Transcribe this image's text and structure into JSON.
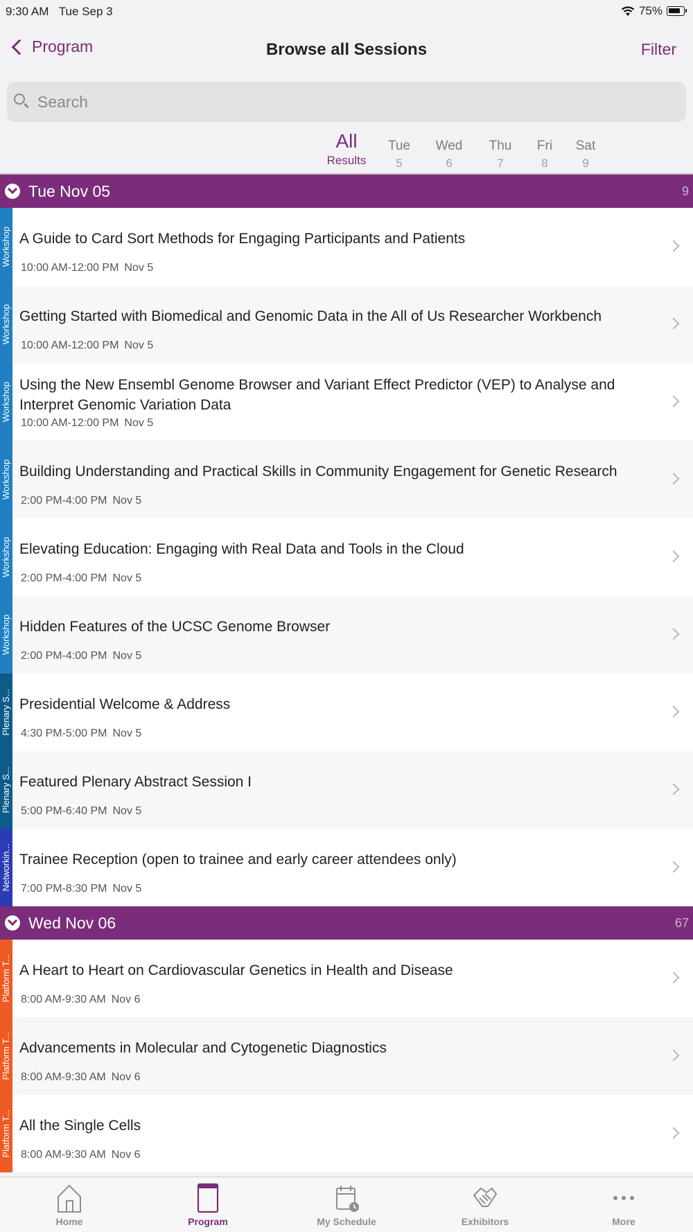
{
  "status_bar": {
    "time": "9:30 AM",
    "date": "Tue Sep 3",
    "battery": "75%"
  },
  "nav": {
    "back_label": "Program",
    "title": "Browse all Sessions",
    "filter_label": "Filter"
  },
  "search": {
    "placeholder": "Search"
  },
  "day_tabs": {
    "all": {
      "label": "All",
      "sublabel": "Results"
    },
    "days": [
      {
        "name": "Tue",
        "num": "5"
      },
      {
        "name": "Wed",
        "num": "6"
      },
      {
        "name": "Thu",
        "num": "7"
      },
      {
        "name": "Fri",
        "num": "8"
      },
      {
        "name": "Sat",
        "num": "9"
      }
    ]
  },
  "colors": {
    "accent": "#7b2c7a",
    "workshop": "#1f7fc2",
    "plenary": "#0d5b8a",
    "networking": "#2b3bb5",
    "platform": "#ee5a24"
  },
  "sections": [
    {
      "title": "Tue Nov 05",
      "count": "9",
      "sessions": [
        {
          "type": "Workshop",
          "title": "A Guide to Card Sort Methods for Engaging Participants and Patients",
          "time": "10:00 AM-12:00 PM",
          "date": "Nov 5"
        },
        {
          "type": "Workshop",
          "title": "Getting Started with Biomedical and Genomic Data in the All of Us Researcher Workbench",
          "time": "10:00 AM-12:00 PM",
          "date": "Nov 5"
        },
        {
          "type": "Workshop",
          "title": "Using the New Ensembl Genome Browser and Variant Effect Predictor (VEP) to Analyse and Interpret Genomic Variation Data",
          "time": "10:00 AM-12:00 PM",
          "date": "Nov 5"
        },
        {
          "type": "Workshop",
          "title": "Building Understanding and Practical Skills in Community Engagement for Genetic Research",
          "time": "2:00 PM-4:00 PM",
          "date": "Nov 5"
        },
        {
          "type": "Workshop",
          "title": "Elevating Education: Engaging with Real Data and Tools in the Cloud",
          "time": "2:00 PM-4:00 PM",
          "date": "Nov 5"
        },
        {
          "type": "Workshop",
          "title": "Hidden Features of the UCSC Genome Browser",
          "time": "2:00 PM-4:00 PM",
          "date": "Nov 5"
        },
        {
          "type": "Plenary S...",
          "title": "Presidential Welcome & Address",
          "time": "4:30 PM-5:00 PM",
          "date": "Nov 5"
        },
        {
          "type": "Plenary S...",
          "title": "Featured Plenary Abstract Session I",
          "time": "5:00 PM-6:40 PM",
          "date": "Nov 5"
        },
        {
          "type": "Networkin...",
          "title": "Trainee Reception (open to trainee and early career attendees only)",
          "time": "7:00 PM-8:30 PM",
          "date": "Nov 5"
        }
      ]
    },
    {
      "title": "Wed Nov 06",
      "count": "67",
      "sessions": [
        {
          "type": "Platform T...",
          "title": "A Heart to Heart on Cardiovascular Genetics in Health and Disease",
          "time": "8:00 AM-9:30 AM",
          "date": "Nov 6"
        },
        {
          "type": "Platform T...",
          "title": "Advancements in Molecular and Cytogenetic Diagnostics",
          "time": "8:00 AM-9:30 AM",
          "date": "Nov 6"
        },
        {
          "type": "Platform T...",
          "title": "All the Single Cells",
          "time": "8:00 AM-9:30 AM",
          "date": "Nov 6"
        }
      ]
    }
  ],
  "tab_bar": [
    {
      "label": "Home",
      "icon": "home-icon"
    },
    {
      "label": "Program",
      "icon": "program-book-icon"
    },
    {
      "label": "My Schedule",
      "icon": "calendar-clock-icon"
    },
    {
      "label": "Exhibitors",
      "icon": "handshake-icon"
    },
    {
      "label": "More",
      "icon": "more-dots-icon"
    }
  ]
}
